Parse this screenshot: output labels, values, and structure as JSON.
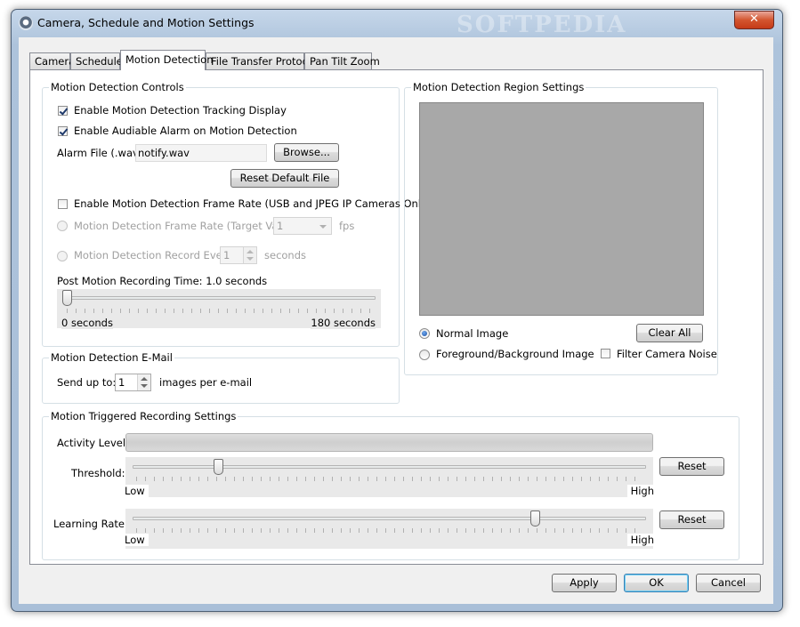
{
  "window": {
    "title": "Camera, Schedule and Motion Settings",
    "watermark": "SOFTPEDIA",
    "close_glyph": "✕",
    "icon": "camera-icon"
  },
  "tabs": [
    {
      "label": "Camera",
      "active": false
    },
    {
      "label": "Schedule",
      "active": false
    },
    {
      "label": "Motion Detection",
      "active": true
    },
    {
      "label": "File Transfer Protocol",
      "active": false
    },
    {
      "label": "Pan Tilt Zoom",
      "active": false
    }
  ],
  "controls": {
    "group_title": "Motion Detection Controls",
    "tracking_display": {
      "label": "Enable Motion Detection Tracking Display",
      "checked": true
    },
    "audible_alarm": {
      "label": "Enable Audiable Alarm on Motion Detection",
      "checked": true
    },
    "alarm_file_label": "Alarm File (.wav):",
    "alarm_file_value": "notify.wav",
    "browse_label": "Browse...",
    "reset_file_label": "Reset Default File",
    "frame_rate_enable": {
      "label": "Enable Motion Detection Frame Rate (USB and JPEG IP Cameras Only)",
      "checked": false
    },
    "frame_rate": {
      "label": "Motion Detection Frame Rate (Target Value):",
      "value": "1",
      "unit": "fps"
    },
    "record_every": {
      "label": "Motion Detection Record Every:",
      "value": "1",
      "unit": "seconds"
    },
    "post_motion_label": "Post Motion Recording Time: 1.0 seconds",
    "post_motion_slider": {
      "min_label": "0 seconds",
      "max_label": "180 seconds",
      "value": 0.0
    }
  },
  "email": {
    "group_title": "Motion Detection E-Mail",
    "send_up_to_label": "Send up to:",
    "count": "1",
    "suffix": "images per e-mail"
  },
  "region": {
    "group_title": "Motion Detection Region Settings",
    "normal_image": {
      "label": "Normal Image",
      "selected": true
    },
    "fg_bg_image": {
      "label": "Foreground/Background Image",
      "selected": false
    },
    "clear_all_label": "Clear All",
    "filter_noise": {
      "label": "Filter Camera Noise",
      "checked": false
    },
    "preview_color": "#a8a8a8"
  },
  "recording": {
    "group_title": "Motion Triggered Recording Settings",
    "activity_label": "Activity Level:",
    "threshold": {
      "label": "Threshold:",
      "low": "Low",
      "high": "High",
      "value": 0.16,
      "reset_label": "Reset"
    },
    "learning_rate": {
      "label": "Learning Rate:",
      "low": "Low",
      "high": "High",
      "value": 0.79,
      "reset_label": "Reset"
    }
  },
  "footer": {
    "apply_label": "Apply",
    "ok_label": "OK",
    "cancel_label": "Cancel"
  },
  "colors": {
    "title_bar": "#adc3db",
    "close_button": "#c53a17",
    "radio_selected": "#1d4fa0",
    "default_button_border": "#3c7fb1"
  }
}
